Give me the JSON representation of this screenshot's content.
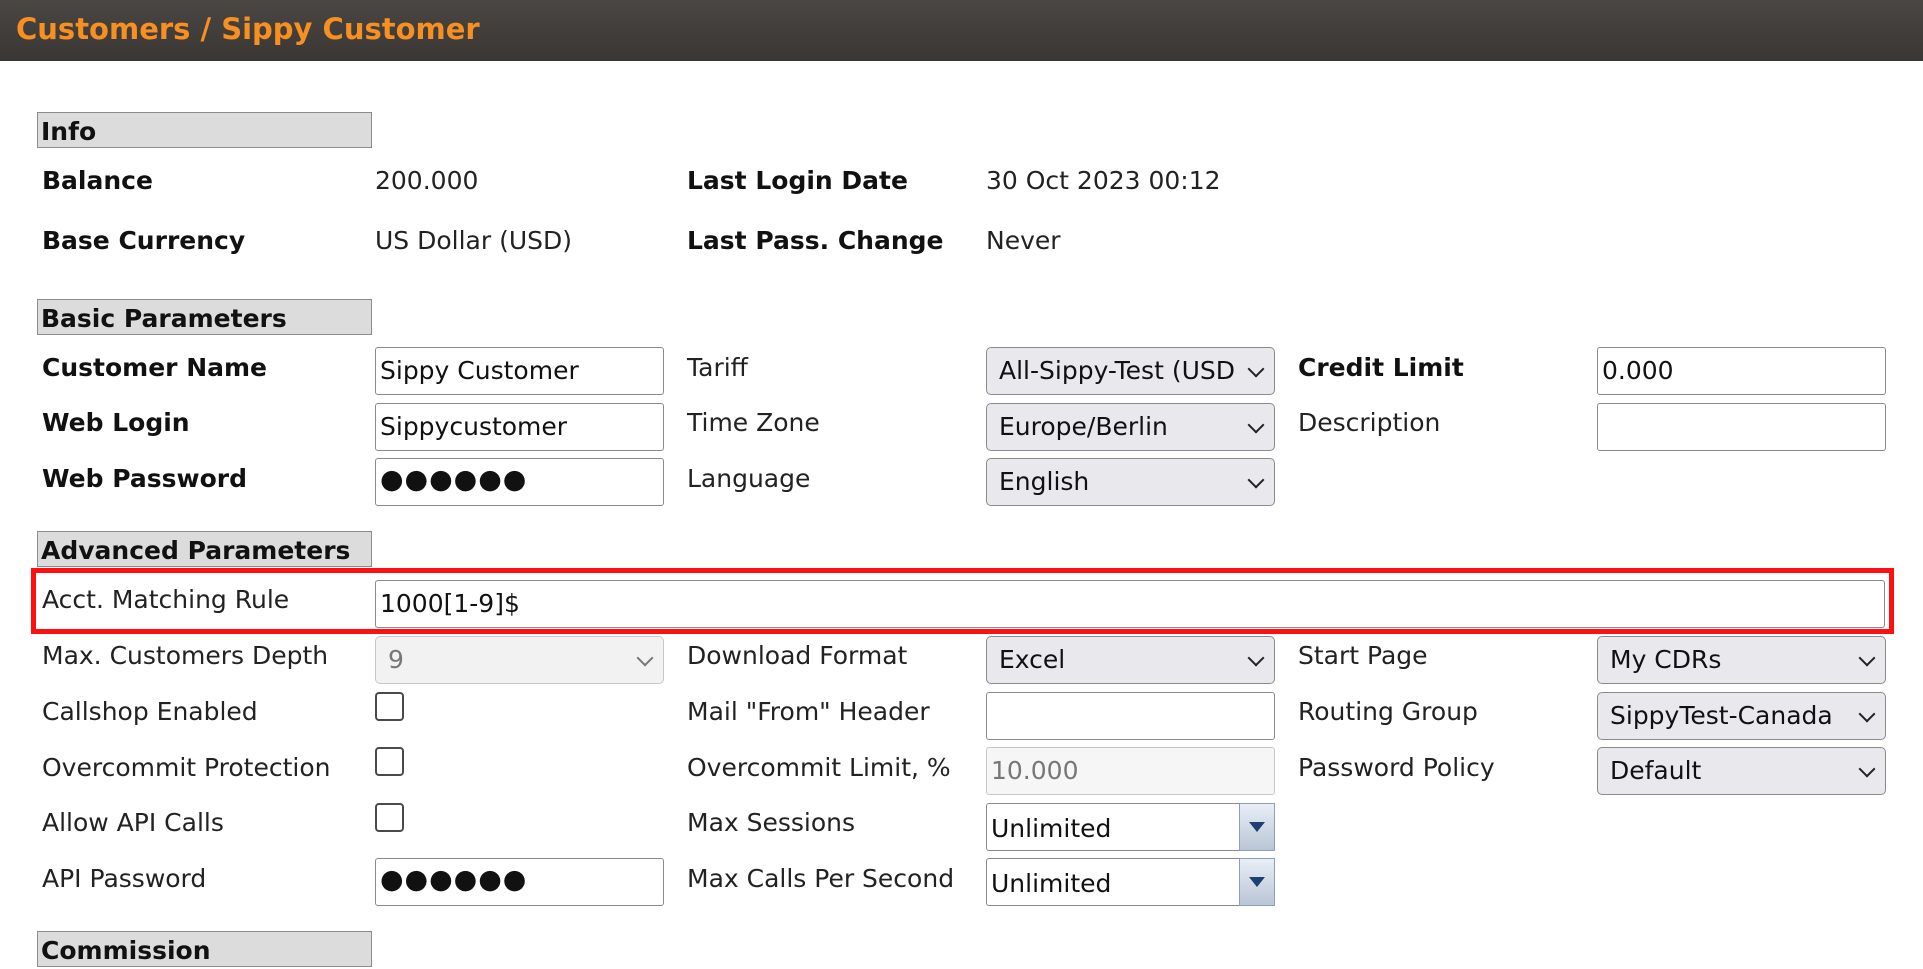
{
  "header": {
    "title": "Customers / Sippy Customer"
  },
  "sections": {
    "info": "Info",
    "basic": "Basic Parameters",
    "advanced": "Advanced Parameters",
    "commission": "Commission"
  },
  "info": {
    "balance_label": "Balance",
    "balance_value": "200.000",
    "base_currency_label": "Base Currency",
    "base_currency_value": "US Dollar (USD)",
    "last_login_label": "Last Login Date",
    "last_login_value": "30 Oct 2023 00:12",
    "last_pass_label": "Last Pass. Change",
    "last_pass_value": "Never"
  },
  "basic": {
    "customer_name_label": "Customer Name",
    "customer_name_value": "Sippy Customer",
    "web_login_label": "Web Login",
    "web_login_value": "Sippycustomer",
    "web_password_label": "Web Password",
    "web_password_value": "●●●●●●",
    "tariff_label": "Tariff",
    "tariff_value": "All-Sippy-Test (USD",
    "timezone_label": "Time Zone",
    "timezone_value": "Europe/Berlin",
    "language_label": "Language",
    "language_value": "English",
    "credit_limit_label": "Credit Limit",
    "credit_limit_value": "0.000",
    "description_label": "Description",
    "description_value": ""
  },
  "advanced": {
    "acct_rule_label": "Acct. Matching Rule",
    "acct_rule_value": "1000[1-9]$",
    "max_depth_label": "Max. Customers Depth",
    "max_depth_value": "9",
    "callshop_label": "Callshop Enabled",
    "callshop_checked": false,
    "overcommit_label": "Overcommit Protection",
    "overcommit_checked": false,
    "api_calls_label": "Allow API Calls",
    "api_calls_checked": false,
    "api_password_label": "API Password",
    "api_password_value": "●●●●●●",
    "download_format_label": "Download Format",
    "download_format_value": "Excel",
    "mail_from_label": "Mail \"From\" Header",
    "mail_from_value": "",
    "overcommit_limit_label": "Overcommit Limit, %",
    "overcommit_limit_value": "10.000",
    "max_sessions_label": "Max Sessions",
    "max_sessions_value": "Unlimited",
    "max_cps_label": "Max Calls Per Second",
    "max_cps_value": "Unlimited",
    "start_page_label": "Start Page",
    "start_page_value": "My CDRs",
    "routing_group_label": "Routing Group",
    "routing_group_value": "SippyTest-Canada",
    "password_policy_label": "Password Policy",
    "password_policy_value": "Default"
  },
  "colors": {
    "header_bg": "#3f3b39",
    "header_text": "#f79020",
    "section_bg": "#dcdcdc",
    "highlight": "#ff1010"
  }
}
